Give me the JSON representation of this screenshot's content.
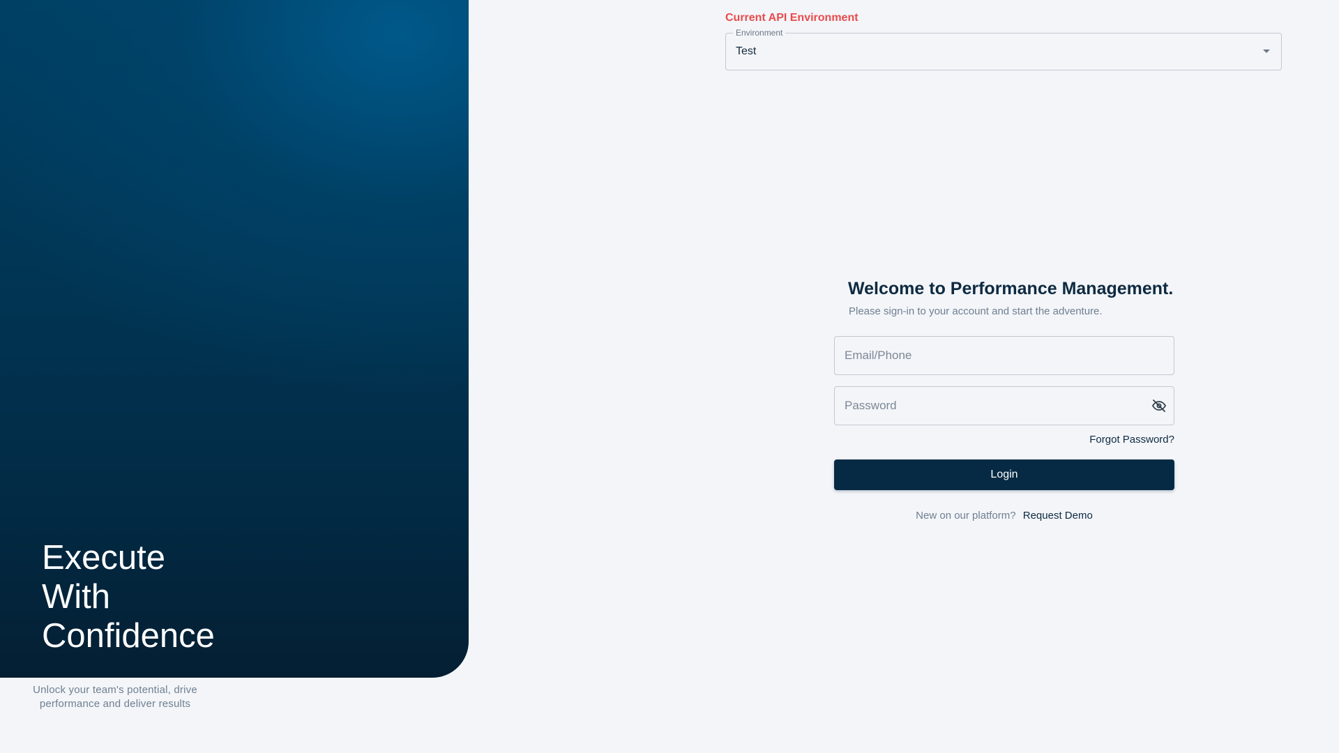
{
  "hero": {
    "title_lines": [
      "Execute",
      "With",
      "Confidence"
    ],
    "subtitle": "Unlock your team's potential, drive performance and deliver results"
  },
  "environment": {
    "heading": "Current API Environment",
    "select_label": "Environment",
    "selected_value": "Test",
    "heading_color": "#ea4b4b"
  },
  "login": {
    "title": "Welcome to Performance Management.",
    "subtitle": "Please sign-in to your account and start the adventure.",
    "email_placeholder": "Email/Phone",
    "email_value": "",
    "password_placeholder": "Password",
    "password_value": "",
    "password_toggle_icon": "eye-off-icon",
    "forgot_password": "Forgot Password?",
    "login_button": "Login",
    "signup_prompt": "New on our platform?",
    "request_demo": "Request Demo"
  },
  "colors": {
    "primary": "#062a44",
    "background": "#f3f5f9",
    "accent_red": "#ea4b4b"
  }
}
